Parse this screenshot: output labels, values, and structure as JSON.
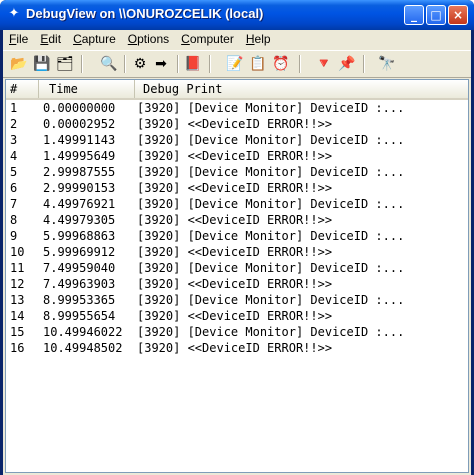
{
  "window": {
    "title": "DebugView on \\\\ONUROZCELIK (local)",
    "minimize_label": "_",
    "maximize_label": "□",
    "close_label": "×"
  },
  "menu": [
    "File",
    "Edit",
    "Capture",
    "Options",
    "Computer",
    "Help"
  ],
  "menu_underline": [
    "F",
    "E",
    "C",
    "O",
    "C",
    "H"
  ],
  "toolbar": {
    "icons": [
      "open-icon",
      "save-icon",
      "save-as-icon",
      "find-icon",
      "capture-icon",
      "autoscroll-icon",
      "clear-icon",
      "filter-icon",
      "highlight-icon",
      "clock-icon",
      "history-icon",
      "log-icon",
      "search-icon"
    ]
  },
  "columns": {
    "num": "#",
    "time": "Time",
    "print": "Debug Print"
  },
  "rows": [
    {
      "num": "1",
      "time": "0.00000000",
      "msg": "[3920] [Device Monitor] DeviceID :..."
    },
    {
      "num": "2",
      "time": "0.00002952",
      "msg": "[3920] <<DeviceID ERROR!!>>"
    },
    {
      "num": "3",
      "time": "1.49991143",
      "msg": "[3920] [Device Monitor] DeviceID :..."
    },
    {
      "num": "4",
      "time": "1.49995649",
      "msg": "[3920] <<DeviceID ERROR!!>>"
    },
    {
      "num": "5",
      "time": "2.99987555",
      "msg": "[3920] [Device Monitor] DeviceID :..."
    },
    {
      "num": "6",
      "time": "2.99990153",
      "msg": "[3920] <<DeviceID ERROR!!>>"
    },
    {
      "num": "7",
      "time": "4.49976921",
      "msg": "[3920] [Device Monitor] DeviceID :..."
    },
    {
      "num": "8",
      "time": "4.49979305",
      "msg": "[3920] <<DeviceID ERROR!!>>"
    },
    {
      "num": "9",
      "time": "5.99968863",
      "msg": "[3920] [Device Monitor] DeviceID :..."
    },
    {
      "num": "10",
      "time": "5.99969912",
      "msg": "[3920] <<DeviceID ERROR!!>>"
    },
    {
      "num": "11",
      "time": "7.49959040",
      "msg": "[3920] [Device Monitor] DeviceID :..."
    },
    {
      "num": "12",
      "time": "7.49963903",
      "msg": "[3920] <<DeviceID ERROR!!>>"
    },
    {
      "num": "13",
      "time": "8.99953365",
      "msg": "[3920] [Device Monitor] DeviceID :..."
    },
    {
      "num": "14",
      "time": "8.99955654",
      "msg": "[3920] <<DeviceID ERROR!!>>"
    },
    {
      "num": "15",
      "time": "10.49946022",
      "msg": "[3920] [Device Monitor] DeviceID :..."
    },
    {
      "num": "16",
      "time": "10.49948502",
      "msg": "[3920] <<DeviceID ERROR!!>>"
    }
  ]
}
